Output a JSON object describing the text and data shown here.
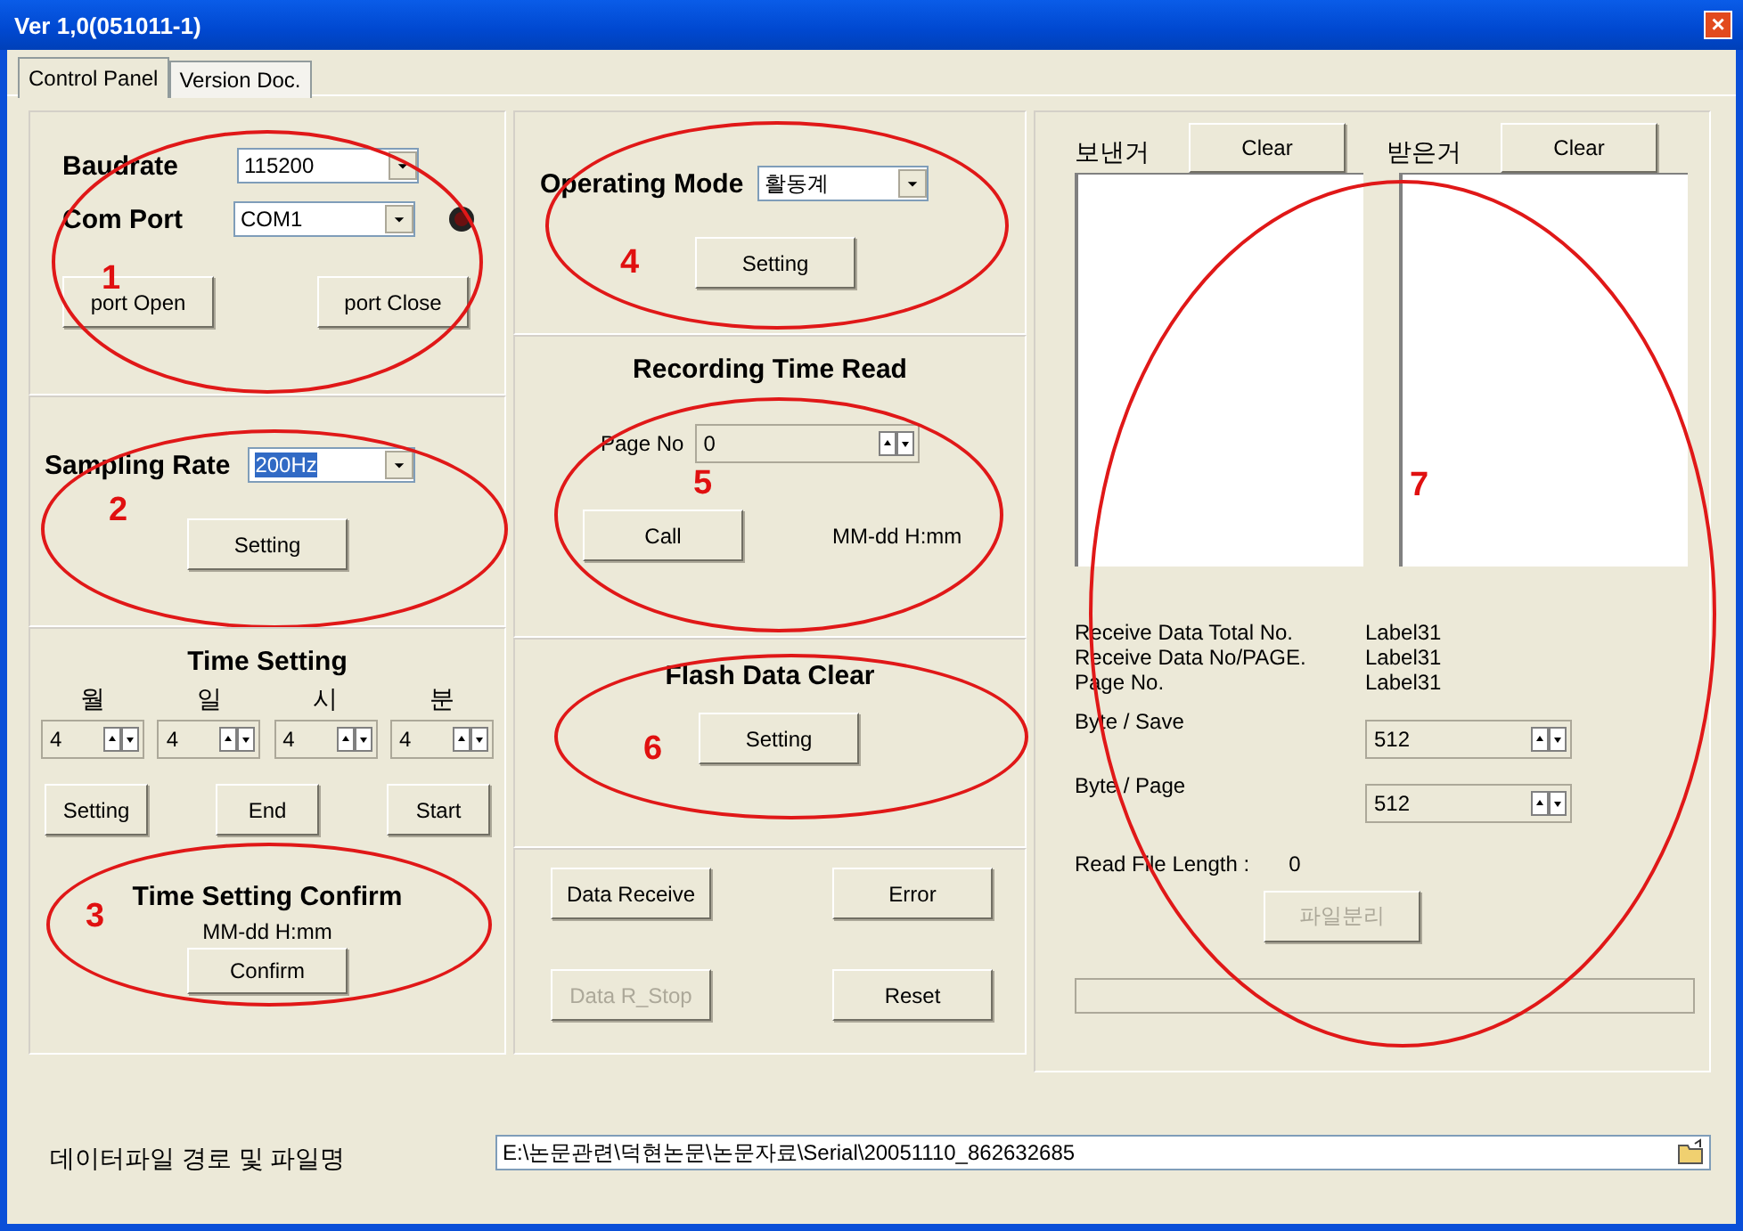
{
  "window": {
    "title": "Ver 1,0(051011-1)",
    "close": "×"
  },
  "tabs": [
    {
      "label": "Control Panel",
      "selected": true
    },
    {
      "label": "Version Doc.",
      "selected": false
    }
  ],
  "port_panel": {
    "annotation": "1",
    "fields": [
      {
        "label": "Baudrate",
        "value": "115200"
      },
      {
        "label": "Com Port",
        "value": "COM1"
      }
    ],
    "buttons": [
      "port Open",
      "port Close"
    ]
  },
  "sampling_panel": {
    "annotation": "2",
    "label": "Sampling Rate",
    "value": "200Hz",
    "value_selected": true,
    "button": "Setting"
  },
  "time_panel": {
    "annotation": "3",
    "title": "Time Setting",
    "spinners": [
      {
        "label": "월",
        "value": "4"
      },
      {
        "label": "일",
        "value": "4"
      },
      {
        "label": "시",
        "value": "4"
      },
      {
        "label": "분",
        "value": "4"
      }
    ],
    "buttons": [
      "Setting",
      "End",
      "Start"
    ],
    "confirm_title": "Time Setting Confirm",
    "confirm_format": "MM-dd  H:mm",
    "confirm_button": "Confirm"
  },
  "mode_panel": {
    "annotation": "4",
    "label": "Operating Mode",
    "value": "활동계",
    "button": "Setting"
  },
  "recording_panel": {
    "annotation": "5",
    "title": "Recording Time Read",
    "page_label": "Page No",
    "page_value": "0",
    "button": "Call",
    "time_format": "MM-dd  H:mm"
  },
  "flash_panel": {
    "annotation": "6",
    "title": "Flash Data Clear",
    "button": "Setting"
  },
  "data_panel": {
    "buttons": [
      {
        "label": "Data Receive",
        "disabled": false
      },
      {
        "label": "Error",
        "disabled": false
      },
      {
        "label": "Data R_Stop",
        "disabled": true
      },
      {
        "label": "Reset",
        "disabled": false
      }
    ]
  },
  "log_panel": {
    "annotation": "7",
    "logs": [
      {
        "label": "보낸거",
        "button": "Clear"
      },
      {
        "label": "받은거",
        "button": "Clear"
      }
    ],
    "stats": [
      {
        "label": "Receive Data Total No.",
        "value": "Label31"
      },
      {
        "label": "Receive Data No/PAGE.",
        "value": "Label31"
      },
      {
        "label": "Page No.",
        "value": "Label31"
      }
    ],
    "spinners": [
      {
        "label": "Byte / Save",
        "value": "512"
      },
      {
        "label": "Byte / Page",
        "value": "512"
      }
    ],
    "file_length_label": "Read File Length :",
    "file_length_value": "0",
    "split_button": {
      "label": "파일분리",
      "disabled": true
    }
  },
  "file_path": {
    "label": "데이터파일 경로 및 파일명",
    "value": "E:\\논문관련\\덕현논문\\논문자료\\Serial\\20051110_862632685"
  }
}
